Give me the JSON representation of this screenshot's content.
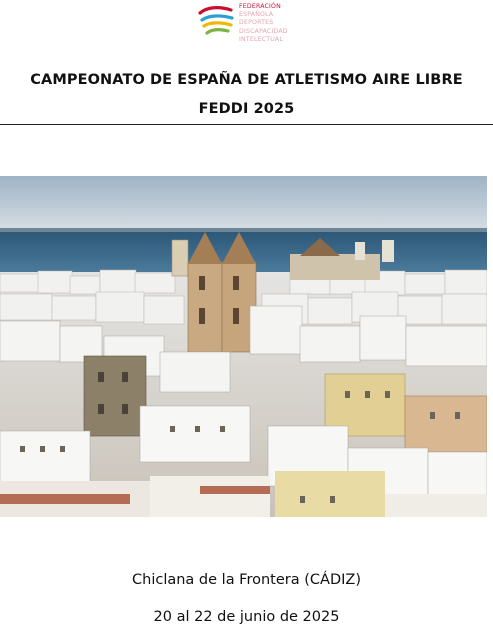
{
  "logo": {
    "lines_primary": [
      "FEDERACIÓN"
    ],
    "lines_secondary": [
      "ESPAÑOLA",
      "DEPORTES",
      "DISCAPACIDAD",
      "INTELECTUAL"
    ],
    "colors": [
      "#c8102e",
      "#2a9fd6",
      "#f2b705",
      "#7cb342"
    ]
  },
  "title": {
    "line1": "CAMPEONATO DE ESPAÑA DE ATLETISMO AIRE LIBRE",
    "line2": "FEDDI 2025"
  },
  "footer": {
    "location": "Chiclana de la Frontera (CÁDIZ)",
    "dates": "20 al 22 de junio de 2025"
  }
}
